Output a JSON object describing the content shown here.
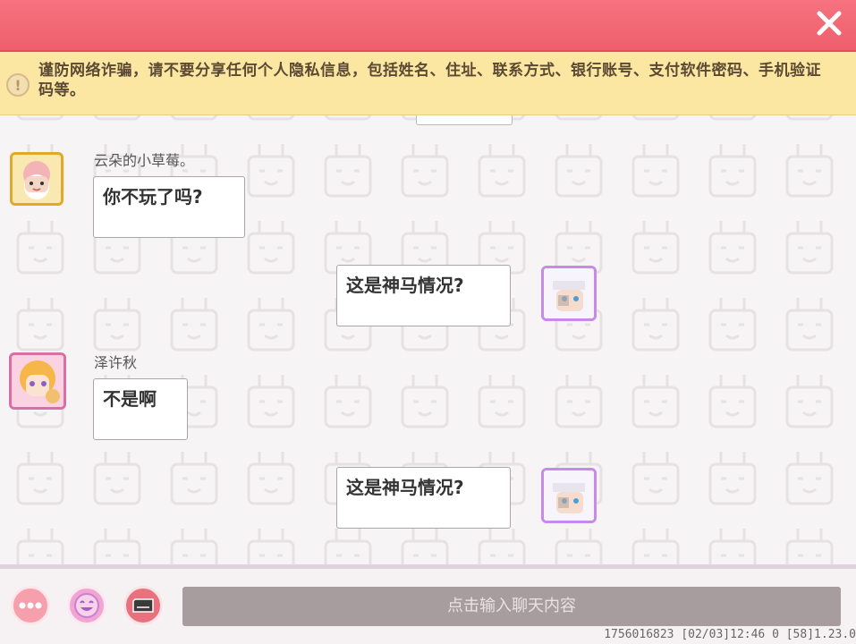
{
  "notice": {
    "text": "谨防网络诈骗，请不要分享任何个人隐私信息，包括姓名、住址、联系方式、银行账号、支付软件密码、手机验证码等。"
  },
  "messages": [
    {
      "side": "left",
      "name": "云朵的小草莓。",
      "text": "你不玩了吗?"
    },
    {
      "side": "right",
      "text": "这是神马情况?"
    },
    {
      "side": "left",
      "name": "泽许秋",
      "text": "不是啊"
    },
    {
      "side": "right",
      "text": "这是神马情况?"
    }
  ],
  "input": {
    "placeholder": "点击输入聊天内容"
  },
  "status_text": "1756016823   [02/03]12:46 0   [58]1.23.0",
  "colors": {
    "topbar": "#ef5f6c",
    "notice_bg": "#fbe6a2",
    "input_bg": "#a79d9e",
    "more_button": "#f6a0ad",
    "emoji_button": "#f0a6cf",
    "keyboard_button": "#e9707d"
  },
  "icons": {
    "close": "close-icon",
    "notice": "warning-icon",
    "more": "more-icon",
    "emoji": "emoji-icon",
    "keyboard": "keyboard-icon"
  }
}
